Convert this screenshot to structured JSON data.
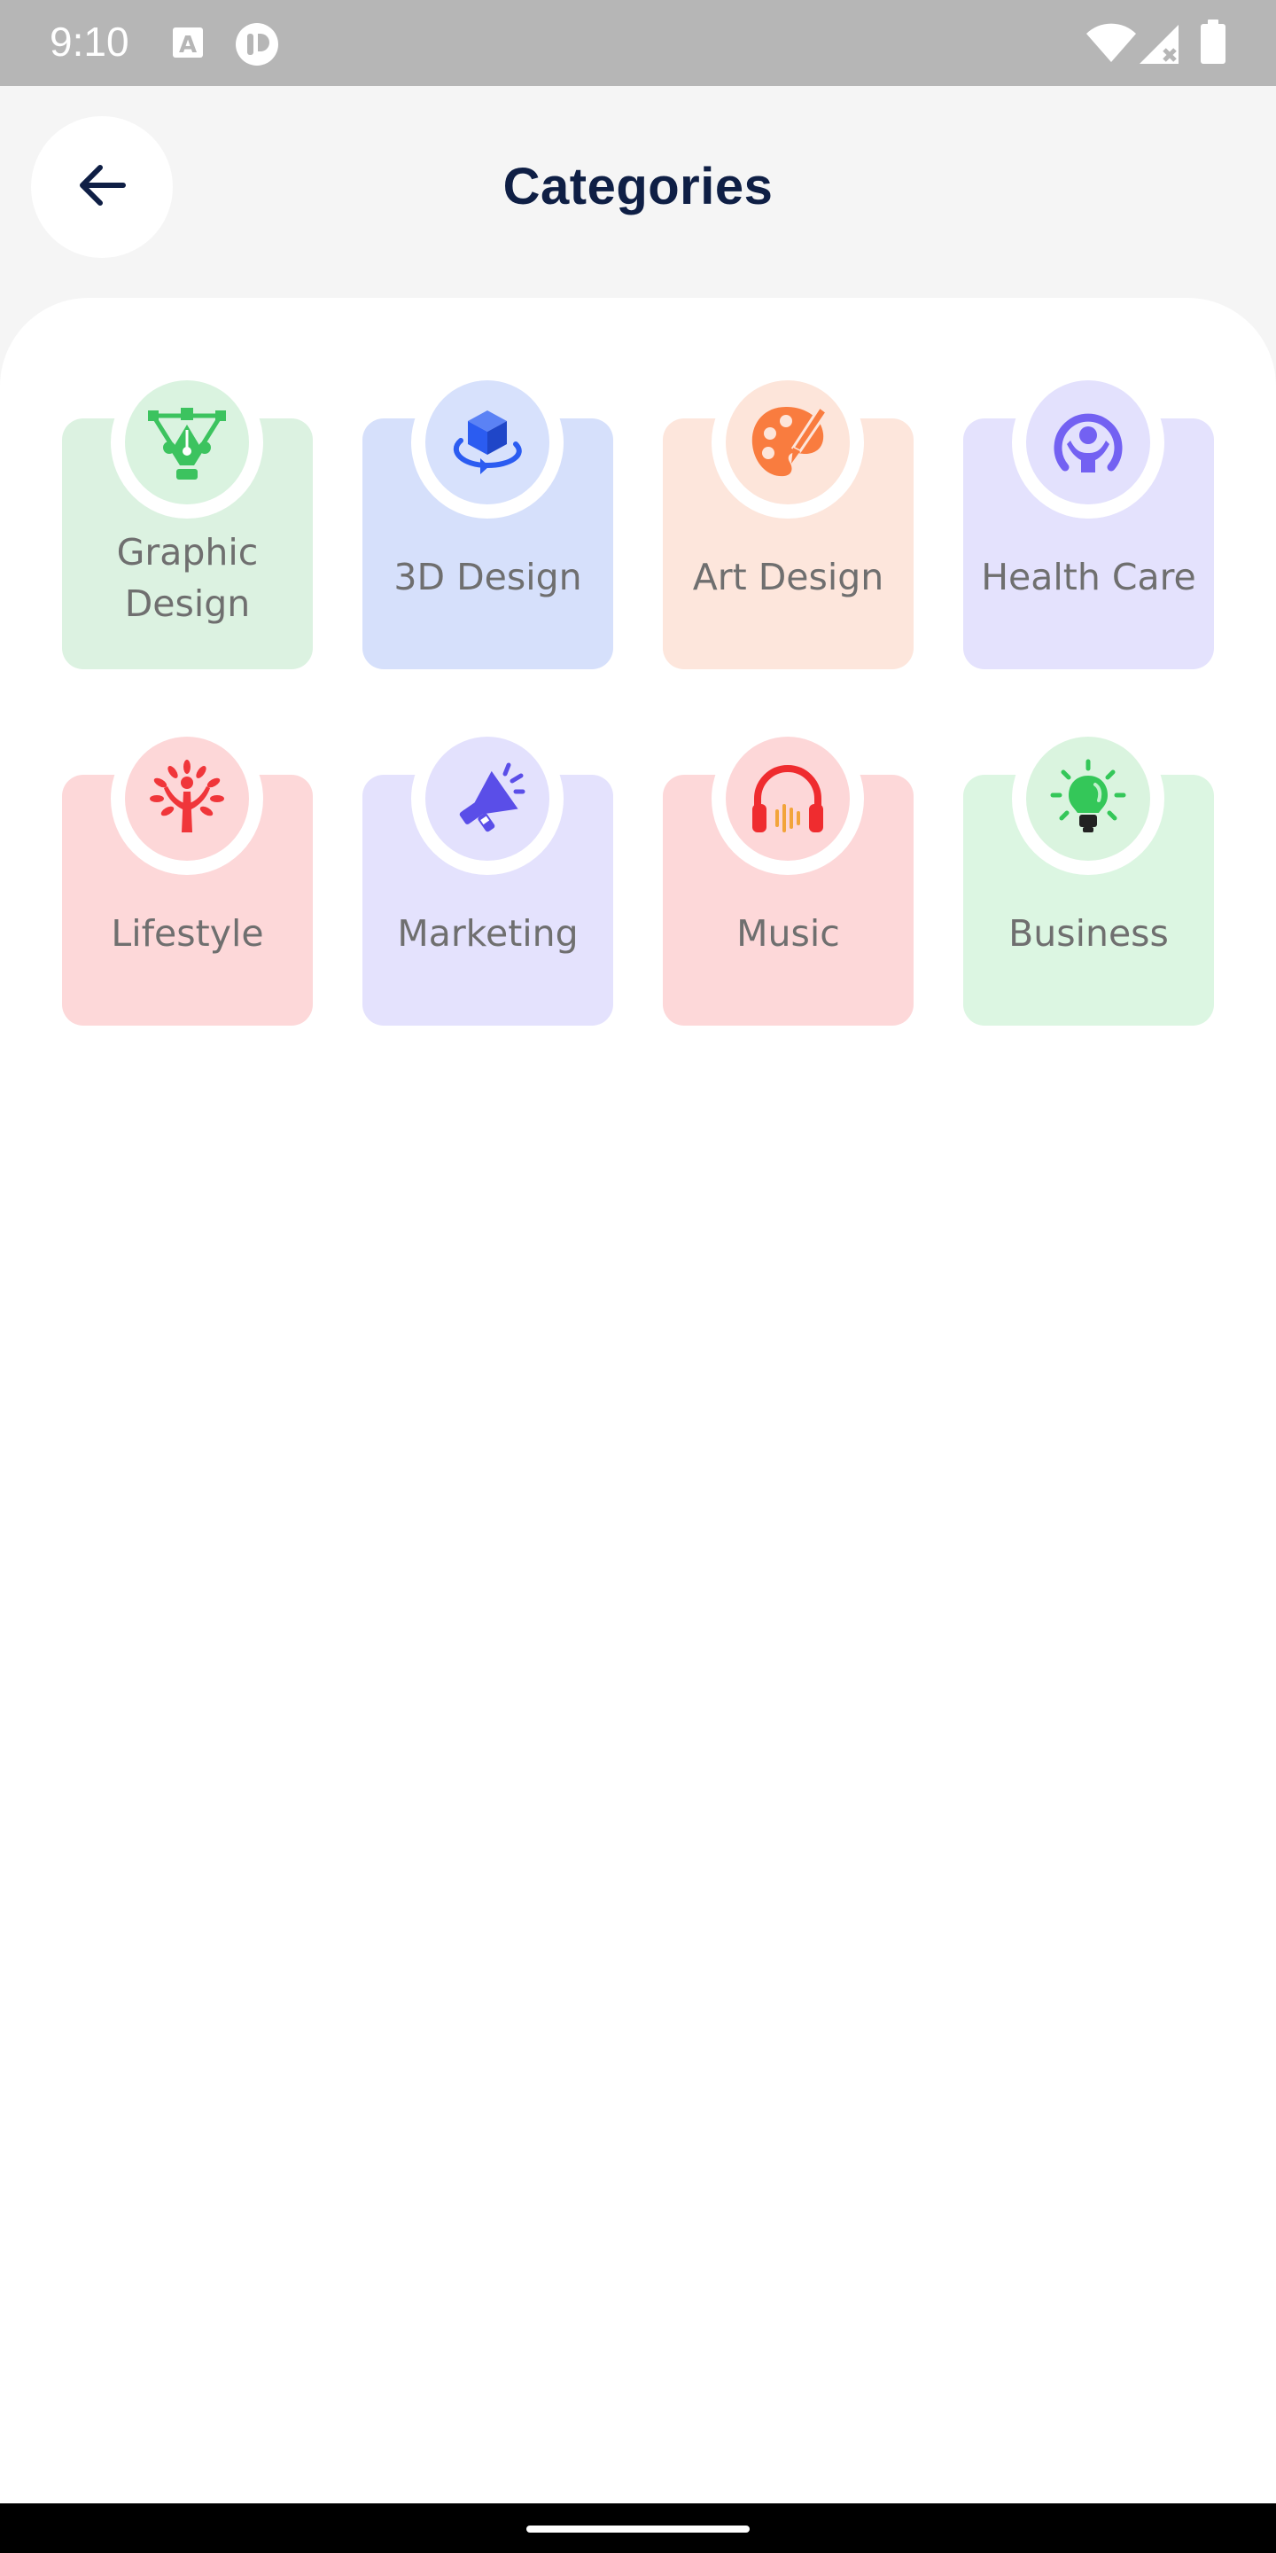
{
  "status_bar": {
    "time": "9:10",
    "icons": [
      "text-a-icon",
      "app-notification-icon",
      "wifi-icon",
      "signal-icon",
      "battery-icon"
    ]
  },
  "header": {
    "back_icon": "arrow-left-icon",
    "title": "Categories"
  },
  "categories": [
    {
      "label": "Graphic Design",
      "icon": "pen-tool-icon",
      "bg": "#dcf2e1",
      "badge": "#daf3e0",
      "accent": "#3cc35f"
    },
    {
      "label": "3D Design",
      "icon": "cube-rotate-icon",
      "bg": "#d6e0fb",
      "badge": "#d7e1fc",
      "accent": "#2b5cf1"
    },
    {
      "label": "Art Design",
      "icon": "palette-icon",
      "bg": "#fde6dc",
      "badge": "#fde5da",
      "accent": "#f97c3f"
    },
    {
      "label": "Health Care",
      "icon": "health-person-icon",
      "bg": "#e4e2fd",
      "badge": "#e3e1fd",
      "accent": "#7361f2"
    },
    {
      "label": "Lifestyle",
      "icon": "tree-person-icon",
      "bg": "#fdd8d9",
      "badge": "#fdd7d8",
      "accent": "#f0363a"
    },
    {
      "label": "Marketing",
      "icon": "megaphone-icon",
      "bg": "#e4e2fd",
      "badge": "#e3e1fd",
      "accent": "#5a4ee8"
    },
    {
      "label": "Music",
      "icon": "headphones-icon",
      "bg": "#fdd8d9",
      "badge": "#fdd7d8",
      "accent": "#ef2c2f"
    },
    {
      "label": "Business",
      "icon": "lightbulb-icon",
      "bg": "#dcf6e2",
      "badge": "#daf4df",
      "accent": "#34c759"
    }
  ]
}
